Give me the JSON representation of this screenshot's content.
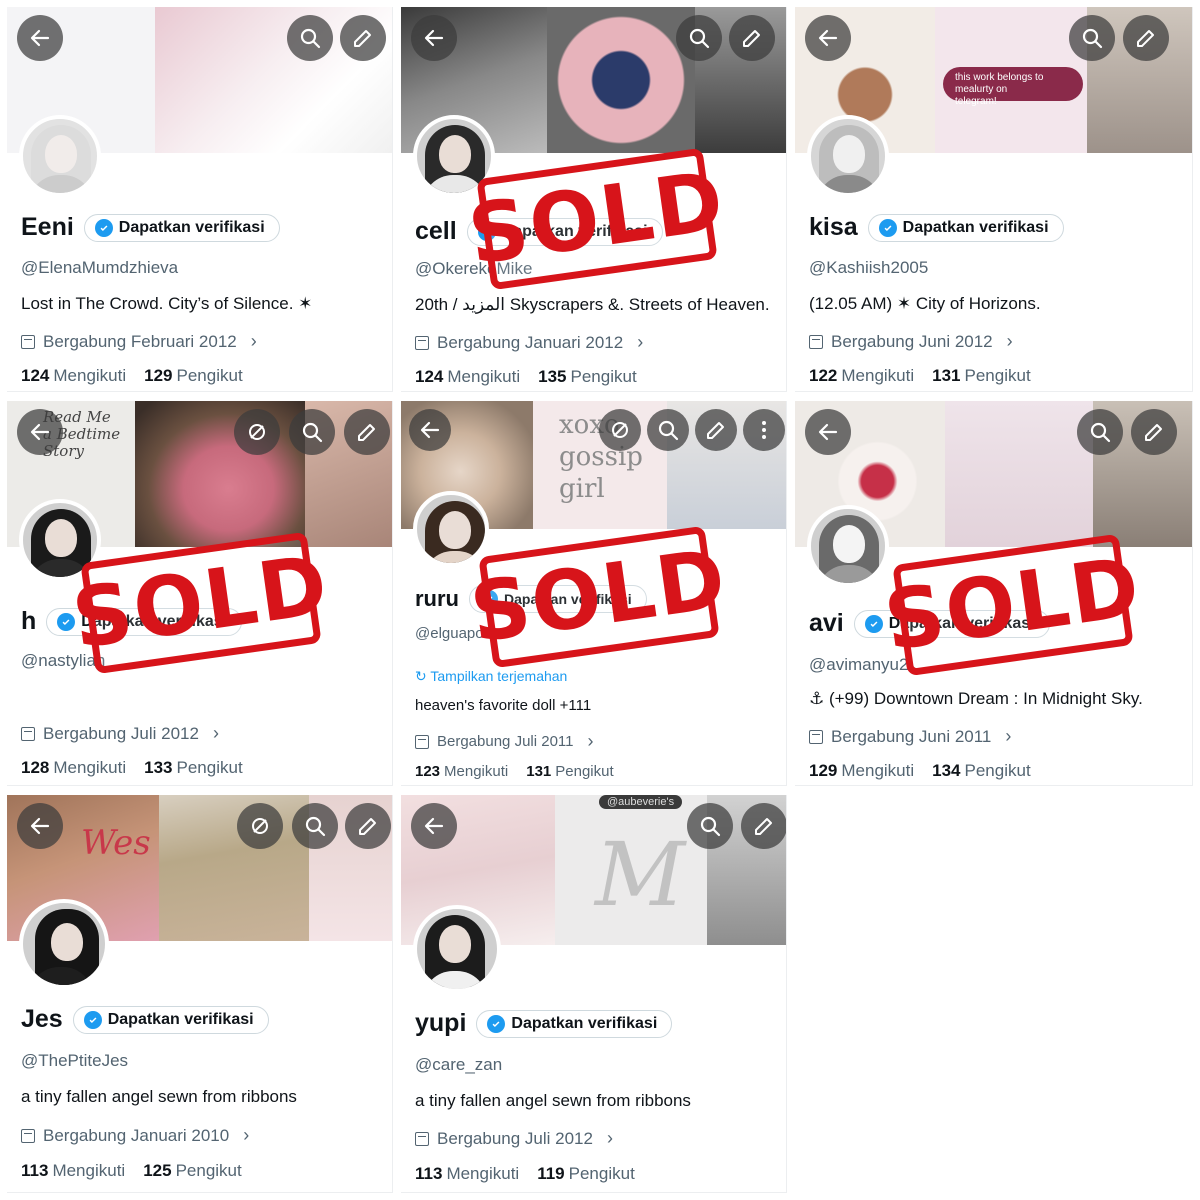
{
  "colors": {
    "verified_blue": "#1d9bf0",
    "sold_red": "#d7141a",
    "secondary_text": "#536471"
  },
  "labels": {
    "verify": "Dapatkan verifikasi",
    "following": "Mengikuti",
    "followers": "Pengikut",
    "sold": "SOLD",
    "translate": "Tampilkan terjemahan"
  },
  "banner_text": {
    "telegram_note": "this work belongs to mealurty on telegram!",
    "gossip_girl": "xoxo gossip girl",
    "bedtime_story": "Read Me a Bedtime Story",
    "wes_anderson": "Wes",
    "aubeverie": "@aubeverie's"
  },
  "profiles": [
    {
      "name": "Eeni",
      "handle": "@ElenaMumdzhieva",
      "bio": "Lost in The Crowd. City’s of Silence. ✶",
      "joined": "Bergabung Februari 2012",
      "following": "124",
      "followers": "129",
      "sold": false
    },
    {
      "name": "cell",
      "handle": "@OkerekeMike",
      "bio": "20th / المزيد Skyscrapers &. Streets of Heaven.",
      "joined": "Bergabung Januari 2012",
      "following": "124",
      "followers": "135",
      "sold": true
    },
    {
      "name": "kisa",
      "handle": "@Kashiish2005",
      "bio": "(12.05 AM) ✶ City of Horizons.",
      "joined": "Bergabung Juni 2012",
      "following": "122",
      "followers": "131",
      "sold": false
    },
    {
      "name": "h",
      "handle": "@nastylian",
      "bio": "",
      "joined": "Bergabung Juli 2012",
      "following": "128",
      "followers": "133",
      "sold": true
    },
    {
      "name": "ruru",
      "handle": "@elguapo",
      "bio": "heaven's favorite doll +111",
      "joined": "Bergabung Juli 2011",
      "following": "123",
      "followers": "131",
      "sold": true
    },
    {
      "name": "avi",
      "handle": "@avimanyu2",
      "bio": "⚓ (+99) Downtown Dream : In Midnight Sky.",
      "joined": "Bergabung Juni 2011",
      "following": "129",
      "followers": "134",
      "sold": true
    },
    {
      "name": "Jes",
      "handle": "@ThePtiteJes",
      "bio": "a tiny fallen angel sewn from ribbons",
      "joined": "Bergabung Januari 2010",
      "following": "113",
      "followers": "125",
      "sold": false
    },
    {
      "name": "yupi",
      "handle": "@care_zan",
      "bio": "a tiny fallen angel sewn from ribbons",
      "joined": "Bergabung Juli 2012",
      "following": "113",
      "followers": "119",
      "sold": false
    }
  ]
}
